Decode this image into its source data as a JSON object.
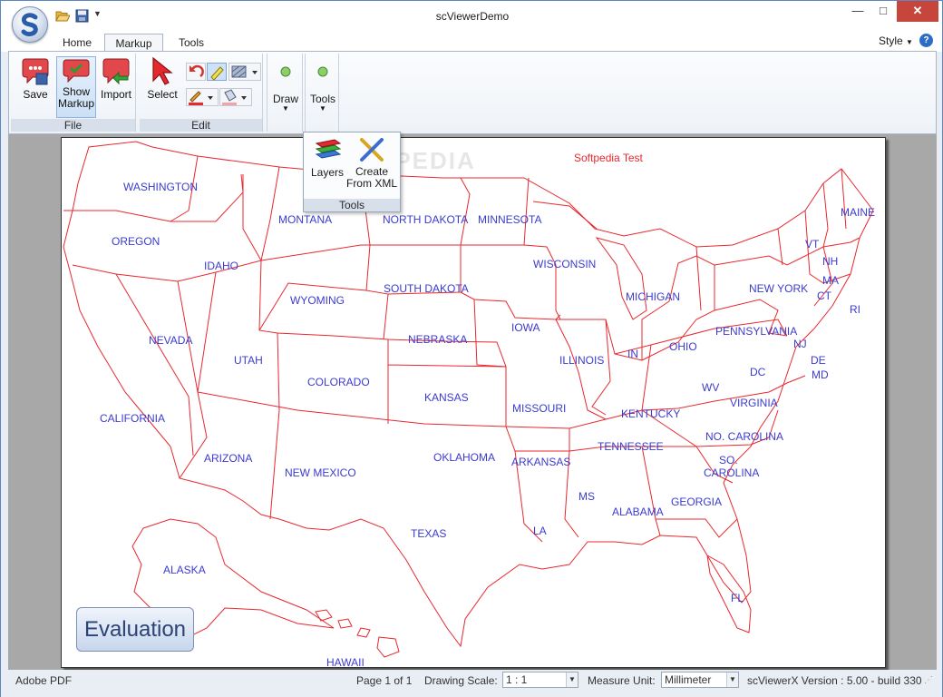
{
  "window": {
    "title": "scViewerDemo"
  },
  "tabs": {
    "home": "Home",
    "markup": "Markup",
    "tools": "Tools"
  },
  "style_menu": "Style",
  "help": "?",
  "ribbon": {
    "file_group": {
      "label": "File",
      "save": "Save",
      "show_markup_1": "Show",
      "show_markup_2": "Markup",
      "import": "Import"
    },
    "edit_group": {
      "label": "Edit",
      "select": "Select"
    },
    "draw_label": "Draw",
    "tools_label": "Tools"
  },
  "tools_popup": {
    "layers": "Layers",
    "create_1": "Create",
    "create_2": "From XML",
    "label": "Tools"
  },
  "document": {
    "watermark": "SOFTPEDIA",
    "title": "Softpedia Test",
    "evaluation": "Evaluation",
    "states": [
      {
        "name": "WASHINGTON"
      },
      {
        "name": "OREGON"
      },
      {
        "name": "IDAHO"
      },
      {
        "name": "MONTANA"
      },
      {
        "name": "NORTH DAKOTA"
      },
      {
        "name": "MINNESOTA"
      },
      {
        "name": "WISCONSIN"
      },
      {
        "name": "MICHIGAN"
      },
      {
        "name": "SOUTH DAKOTA"
      },
      {
        "name": "WYOMING"
      },
      {
        "name": "NEVADA"
      },
      {
        "name": "CALIFORNIA"
      },
      {
        "name": "UTAH"
      },
      {
        "name": "COLORADO"
      },
      {
        "name": "NEBRASKA"
      },
      {
        "name": "IOWA"
      },
      {
        "name": "ILLINOIS"
      },
      {
        "name": "IN"
      },
      {
        "name": "OHIO"
      },
      {
        "name": "PENNSYLVANIA"
      },
      {
        "name": "NEW YORK"
      },
      {
        "name": "VT"
      },
      {
        "name": "NH"
      },
      {
        "name": "MAINE"
      },
      {
        "name": "MA"
      },
      {
        "name": "CT"
      },
      {
        "name": "RI"
      },
      {
        "name": "NJ"
      },
      {
        "name": "DE"
      },
      {
        "name": "MD"
      },
      {
        "name": "DC"
      },
      {
        "name": "WV"
      },
      {
        "name": "VIRGINIA"
      },
      {
        "name": "KENTUCKY"
      },
      {
        "name": "KANSAS"
      },
      {
        "name": "MISSOURI"
      },
      {
        "name": "ARIZONA"
      },
      {
        "name": "NEW MEXICO"
      },
      {
        "name": "OKLAHOMA"
      },
      {
        "name": "ARKANSAS"
      },
      {
        "name": "TENNESSEE"
      },
      {
        "name": "NO. CAROLINA"
      },
      {
        "name": "SO."
      },
      {
        "name": "CAROLINA"
      },
      {
        "name": "TEXAS"
      },
      {
        "name": "MS"
      },
      {
        "name": "ALABAMA"
      },
      {
        "name": "GEORGIA"
      },
      {
        "name": "LA"
      },
      {
        "name": "FL"
      },
      {
        "name": "ALASKA"
      },
      {
        "name": "HAWAII"
      }
    ]
  },
  "status": {
    "doc_type": "Adobe PDF",
    "page": "Page 1 of 1",
    "scale_label": "Drawing Scale:",
    "scale_value": "1 : 1",
    "unit_label": "Measure Unit:",
    "unit_value": "Millimeter",
    "version": "scViewerX Version : 5.00 - build 330"
  },
  "colors": {
    "map_line": "#e8282e",
    "map_text": "#3b3bd0",
    "accent": "#2c6dc5",
    "close": "#c7463c"
  }
}
